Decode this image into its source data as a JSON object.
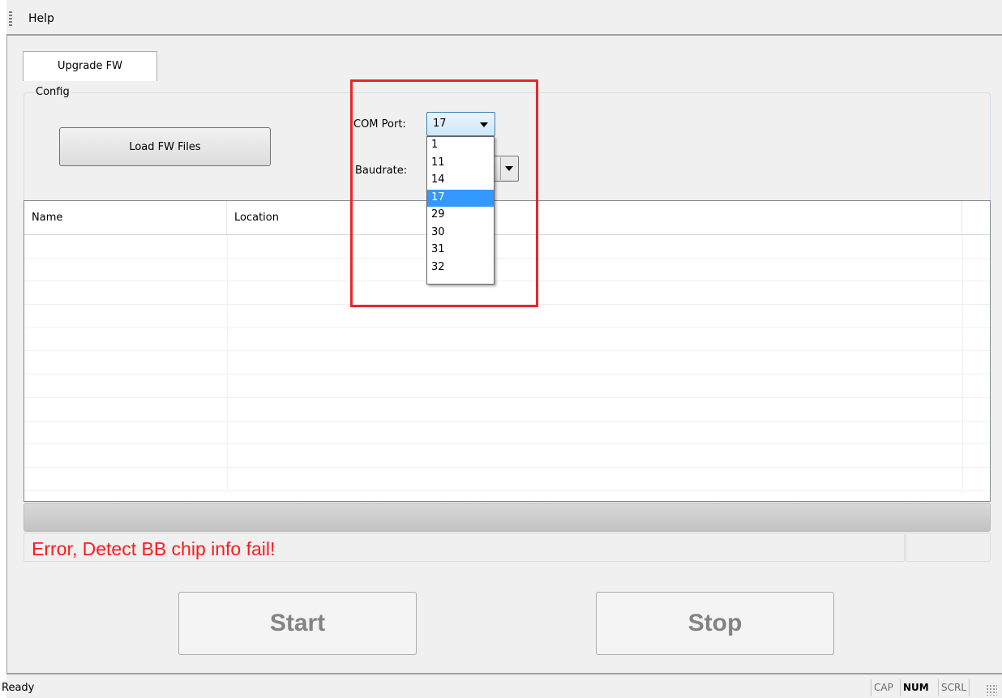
{
  "menu": {
    "items": [
      "Help"
    ]
  },
  "tabs": [
    {
      "label": "Upgrade FW",
      "active": true
    }
  ],
  "config": {
    "title": "Config",
    "load_button": "Load FW Files",
    "com_port": {
      "label": "COM Port:",
      "value": "17",
      "options": [
        "1",
        "11",
        "14",
        "17",
        "29",
        "30",
        "31",
        "32"
      ],
      "selected_index": 3,
      "open": true
    },
    "baudrate": {
      "label": "Baudrate:",
      "value": ""
    }
  },
  "table": {
    "columns": [
      "Name",
      "Location",
      ""
    ],
    "rows": []
  },
  "progress": {
    "fraction": 0
  },
  "status_message": "Error, Detect BB chip info fail!",
  "buttons": {
    "start": "Start",
    "stop": "Stop"
  },
  "statusbar": {
    "text": "Ready",
    "indicators": [
      {
        "label": "CAP",
        "active": false
      },
      {
        "label": "NUM",
        "active": true
      },
      {
        "label": "SCRL",
        "active": false
      }
    ]
  },
  "colors": {
    "error_text": "#ff1a1a",
    "highlight_frame": "#e8262b",
    "selection": "#3399ff"
  }
}
